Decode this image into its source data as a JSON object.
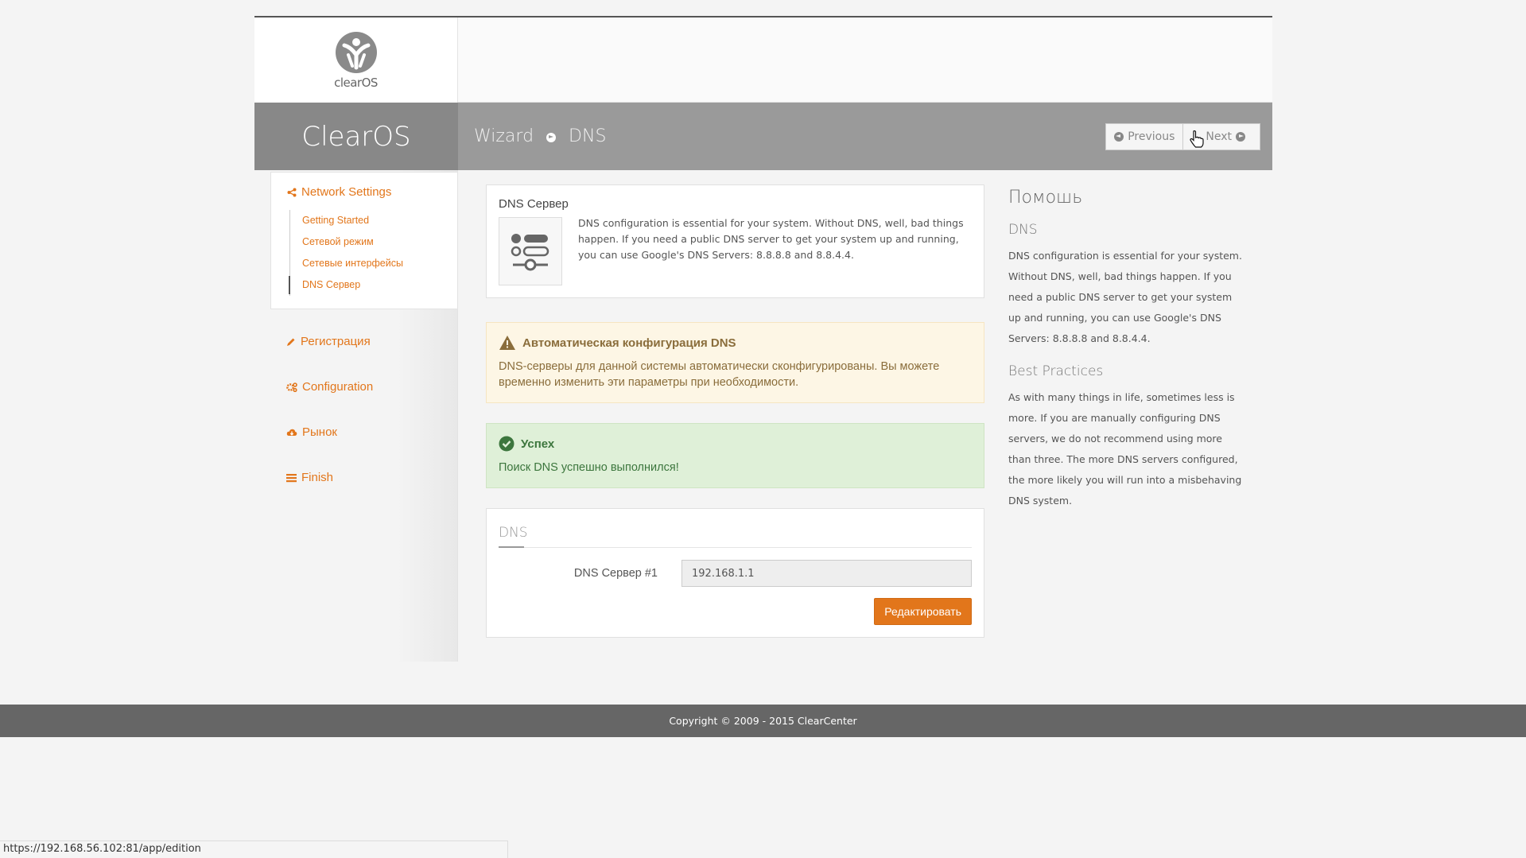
{
  "brand": {
    "logo_text": "clearOS",
    "name": "ClearOS"
  },
  "breadcrumb": {
    "root": "Wizard",
    "current": "DNS"
  },
  "nav_buttons": {
    "previous": "Previous",
    "next": "Next"
  },
  "sidebar": {
    "active_section": "Network Settings",
    "sub_items": [
      {
        "label": "Getting Started"
      },
      {
        "label": "Сетевой режим"
      },
      {
        "label": "Сетевые интерфейсы"
      },
      {
        "label": "DNS Сервер"
      }
    ],
    "sections": [
      {
        "label": "Регистрация",
        "icon": "pencil-icon"
      },
      {
        "label": "Configuration",
        "icon": "gears-icon"
      },
      {
        "label": "Рынок",
        "icon": "cloud-download-icon"
      },
      {
        "label": "Finish",
        "icon": "list-icon"
      }
    ]
  },
  "info_panel": {
    "title": "DNS Сервер",
    "text": "DNS configuration is essential for your system. Without DNS, well, bad things happen. If you need a public DNS server to get your system up and running, you can use Google's DNS Servers: 8.8.8.8 and 8.8.4.4.",
    "icon": "settings-toggles-icon"
  },
  "warning_alert": {
    "title": "Автоматическая конфигурация DNS",
    "body": "DNS-серверы для данной системы автоматически сконфигурированы. Вы можете временно изменить эти параметры при необходимости."
  },
  "success_alert": {
    "title": "Успех",
    "body": "Поиск DNS успешно выполнился!"
  },
  "dns_form": {
    "legend": "DNS",
    "field_label": "DNS Сервер #1",
    "field_value": "192.168.1.1",
    "edit_button": "Редактировать"
  },
  "help": {
    "heading": "Помошь",
    "section1_title": "DNS",
    "section1_text": "DNS configuration is essential for your system. Without DNS, well, bad things happen. If you need a public DNS server to get your system up and running, you can use Google's DNS Servers: 8.8.8.8 and 8.8.4.4.",
    "section2_title": "Best Practices",
    "section2_text": "As with many things in life, sometimes less is more. If you are manually configuring DNS servers, we do not recommend using more than three. The more DNS servers configured, the more likely you will run into a misbehaving DNS system."
  },
  "footer": {
    "copyright": "Copyright © 2009 - 2015 ClearCenter"
  },
  "status_bar": {
    "url": "https://192.168.56.102:81/app/edition"
  },
  "colors": {
    "accent": "#e2761b",
    "warning_bg": "#fdf6e5",
    "success_bg": "#dff0d8",
    "header_bar": "#9a9a9a"
  }
}
